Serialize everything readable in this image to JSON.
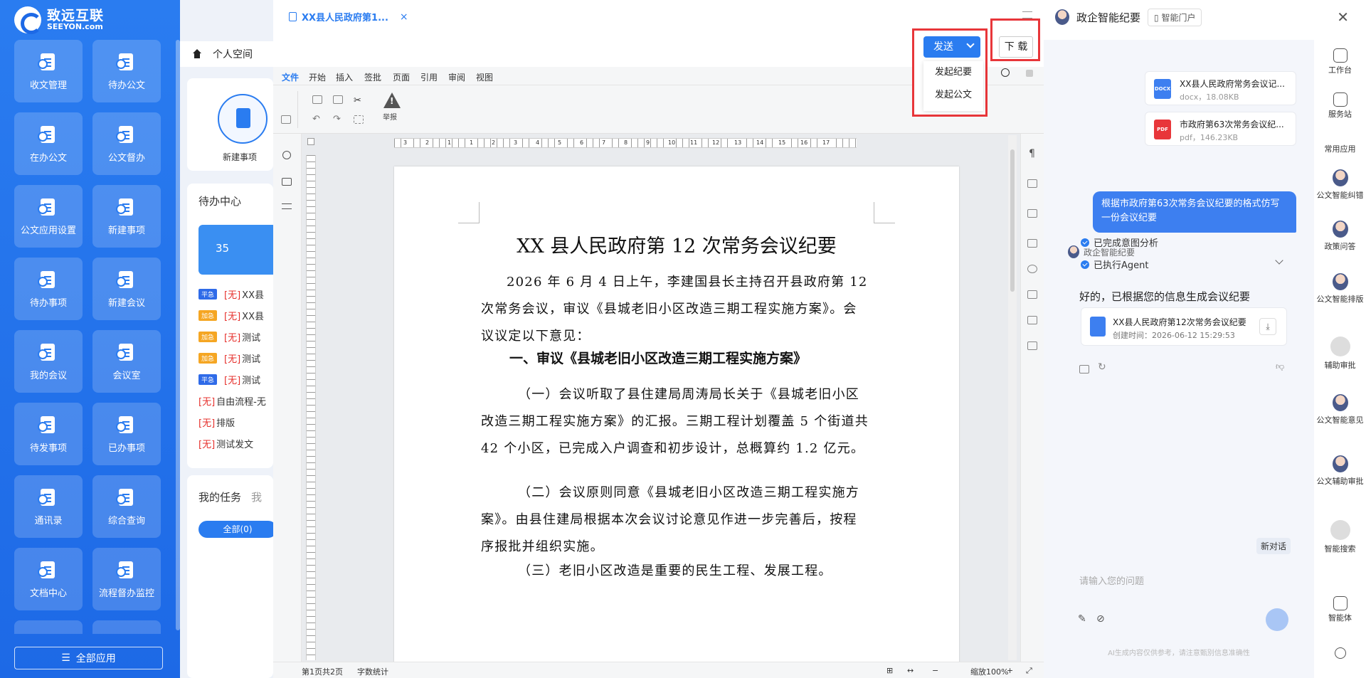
{
  "brand": {
    "name": "致远互联",
    "sub": "SEEYON.com"
  },
  "sidebar": {
    "tiles": [
      "收文管理",
      "待办公文",
      "在办公文",
      "公文督办",
      "公文应用设置",
      "新建事项",
      "待办事项",
      "新建会议",
      "我的会议",
      "会议室",
      "待发事项",
      "已办事项",
      "通讯录",
      "综合查询",
      "文档中心",
      "流程督办监控"
    ],
    "all_apps": "全部应用"
  },
  "mid": {
    "tab": "个人空间",
    "new_item": "新建事项",
    "todo_title": "待办中心",
    "todo_count": "35",
    "todo_rows": [
      {
        "badge": "平急",
        "color": "#2f6be8",
        "tag": "[无]",
        "text": "XX县"
      },
      {
        "badge": "加急",
        "color": "#f5a623",
        "tag": "[无]",
        "text": "XX县"
      },
      {
        "badge": "加急",
        "color": "#f5a623",
        "tag": "[无]",
        "text": "测试"
      },
      {
        "badge": "加急",
        "color": "#f5a623",
        "tag": "[无]",
        "text": "测试"
      },
      {
        "badge": "平急",
        "color": "#2f6be8",
        "tag": "[无]",
        "text": "测试"
      },
      {
        "badge": "",
        "color": "",
        "tag": "[无]",
        "text": "自由流程-无"
      },
      {
        "badge": "",
        "color": "",
        "tag": "[无]",
        "text": "排版"
      },
      {
        "badge": "",
        "color": "",
        "tag": "[无]",
        "text": "测试发文"
      }
    ],
    "task_title": "我的任务",
    "task_title2": "我",
    "task_pill": "全部(0)"
  },
  "editor": {
    "tab_title": "XX县人民政府第1...",
    "tab_close": "×",
    "menu": [
      "文件",
      "开始",
      "插入",
      "签批",
      "页面",
      "引用",
      "审阅",
      "视图"
    ],
    "report": "举报",
    "send": "发送",
    "send_menu": [
      "发起纪要",
      "发起公文"
    ],
    "download": "下 载",
    "doc": {
      "title": "XX 县人民政府第 12 次常务会议纪要",
      "p1": "2026 年 6 月 4 日上午，李建国县长主持召开县政府第 12 次常务会议，审议《县城老旧小区改造三期工程实施方案》。会议议定以下意见：",
      "h1": "一、审议《县城老旧小区改造三期工程实施方案》",
      "p2": "（一）会议听取了县住建局周涛局长关于《县城老旧小区改造三期工程实施方案》的汇报。三期工程计划覆盖 5 个街道共 42 个小区，已完成入户调查和初步设计，总概算约 1.2 亿元。",
      "p3": "（二）会议原则同意《县城老旧小区改造三期工程实施方案》。由县住建局根据本次会议讨论意见作进一步完善后，按程序报批并组织实施。",
      "p4": "（三）老旧小区改造是重要的民生工程、发展工程。"
    },
    "status": {
      "page": "第1页共2页",
      "words": "字数统计",
      "zoom": "缩放100%"
    },
    "ruler_nums": [
      "3",
      "2",
      "1",
      "1",
      "2",
      "3",
      "4",
      "5",
      "6",
      "7",
      "8",
      "9",
      "10",
      "11",
      "12",
      "13",
      "14",
      "15",
      "16",
      "17"
    ]
  },
  "assistant": {
    "title": "政企智能纪要",
    "portal": "智能门户",
    "files": [
      {
        "name": "XX县人民政府常务会议记...",
        "size": "docx，18.08KB",
        "type": "DOCX",
        "color": "#3d7ff0"
      },
      {
        "name": "市政府第63次常务会议纪...",
        "size": "pdf，146.23KB",
        "type": "PDF",
        "color": "#e8363a"
      }
    ],
    "user_msg": "根据市政府第63次常务会议纪要的格式仿写一份会议纪要",
    "agent_name": "政企智能纪要",
    "steps": [
      "已完成意图分析",
      "已执行Agent"
    ],
    "reply": "好的，已根据您的信息生成会议纪要",
    "gen": {
      "name": "XX县人民政府第12次常务会议纪要",
      "time": "创建时间：2026-06-12 15:29:53"
    },
    "new_chat": "新对话",
    "placeholder": "请输入您的问题",
    "disclaimer": "AI生成内容仅供参考，请注意甄别信息准确性",
    "rail": [
      "工作台",
      "服务站",
      "常用应用",
      "公文智能纠错",
      "政策问答",
      "公文智能排版",
      "辅助审批",
      "公文智能意见",
      "公文辅助审批",
      "智能搜索",
      "智能体"
    ]
  }
}
